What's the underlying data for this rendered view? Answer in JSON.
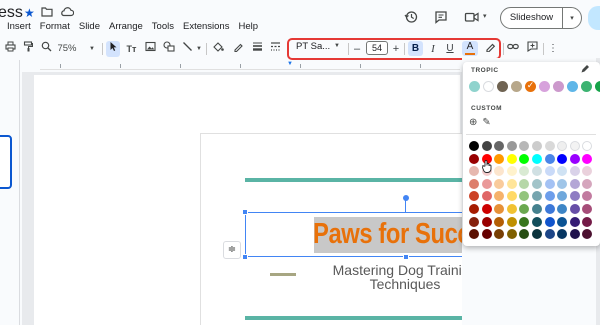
{
  "title_bar": {
    "doc_title": "ess",
    "icons": [
      "star-icon",
      "folder-icon",
      "cloud-icon"
    ]
  },
  "menu": [
    "Insert",
    "Format",
    "Slide",
    "Arrange",
    "Tools",
    "Extensions",
    "Help"
  ],
  "top_right": {
    "icons": [
      "history-icon",
      "comment-icon",
      "video-icon",
      "chevron-down-icon"
    ],
    "slideshow_label": "Slideshow",
    "caret": "▾"
  },
  "toolbar": {
    "zoom": "75%",
    "font_name": "PT Sa...",
    "font_size": "54",
    "minus": "–",
    "plus": "+",
    "bold": "B",
    "italic": "I",
    "underline": "U",
    "text_color_letter": "A"
  },
  "slide": {
    "title": "Paws for Success",
    "subtitle": "Mastering Dog Training Techniques",
    "accent_colors": {
      "teal": "#5ab4a5",
      "olive": "#a7a682",
      "title": "#e8710a"
    }
  },
  "color_picker": {
    "theme_label": "TROPIC",
    "custom_label": "CUSTOM",
    "custom_add": "⊕",
    "custom_pick": "✎",
    "theme_colors": [
      "#8fd3cd",
      "#ffffff",
      "#6f6352",
      "#b7a78a",
      "#e8710a",
      "#d7a2dc",
      "#cc99cc",
      "#5fb6e8",
      "#3cb371",
      "#15a349",
      "#e1e600"
    ],
    "theme_selected_index": 4,
    "grid_rows": [
      [
        "#000000",
        "#434343",
        "#666666",
        "#999999",
        "#b7b7b7",
        "#cccccc",
        "#d9d9d9",
        "#efefef",
        "#f3f3f3",
        "#ffffff"
      ],
      [
        "#980000",
        "#ff0000",
        "#ff9900",
        "#ffff00",
        "#00ff00",
        "#00ffff",
        "#4a86e8",
        "#0000ff",
        "#9900ff",
        "#ff00ff"
      ],
      [
        "#e6b8af",
        "#f4cccc",
        "#fce5cd",
        "#fff2cc",
        "#d9ead3",
        "#d0e0e3",
        "#c9daf8",
        "#cfe2f3",
        "#d9d2e9",
        "#ead1dc"
      ],
      [
        "#dd7e6b",
        "#ea9999",
        "#f9cb9c",
        "#ffe599",
        "#b6d7a8",
        "#a2c4c9",
        "#a4c2f4",
        "#9fc5e8",
        "#b4a7d6",
        "#d5a6bd"
      ],
      [
        "#cc4125",
        "#e06666",
        "#f6b26b",
        "#ffd966",
        "#93c47d",
        "#76a5af",
        "#6d9eeb",
        "#6fa8dc",
        "#8e7cc3",
        "#c27ba0"
      ],
      [
        "#a61c00",
        "#cc0000",
        "#e69138",
        "#f1c232",
        "#6aa84f",
        "#45818e",
        "#3c78d8",
        "#3d85c6",
        "#674ea7",
        "#a64d79"
      ],
      [
        "#85200c",
        "#990000",
        "#b45f06",
        "#bf9000",
        "#38761d",
        "#134f5c",
        "#1155cc",
        "#0b5394",
        "#351c75",
        "#741b47"
      ],
      [
        "#5b0f00",
        "#660000",
        "#783f04",
        "#7f6000",
        "#274e13",
        "#0c343d",
        "#1c4587",
        "#073763",
        "#20124d",
        "#4c1130"
      ]
    ]
  }
}
